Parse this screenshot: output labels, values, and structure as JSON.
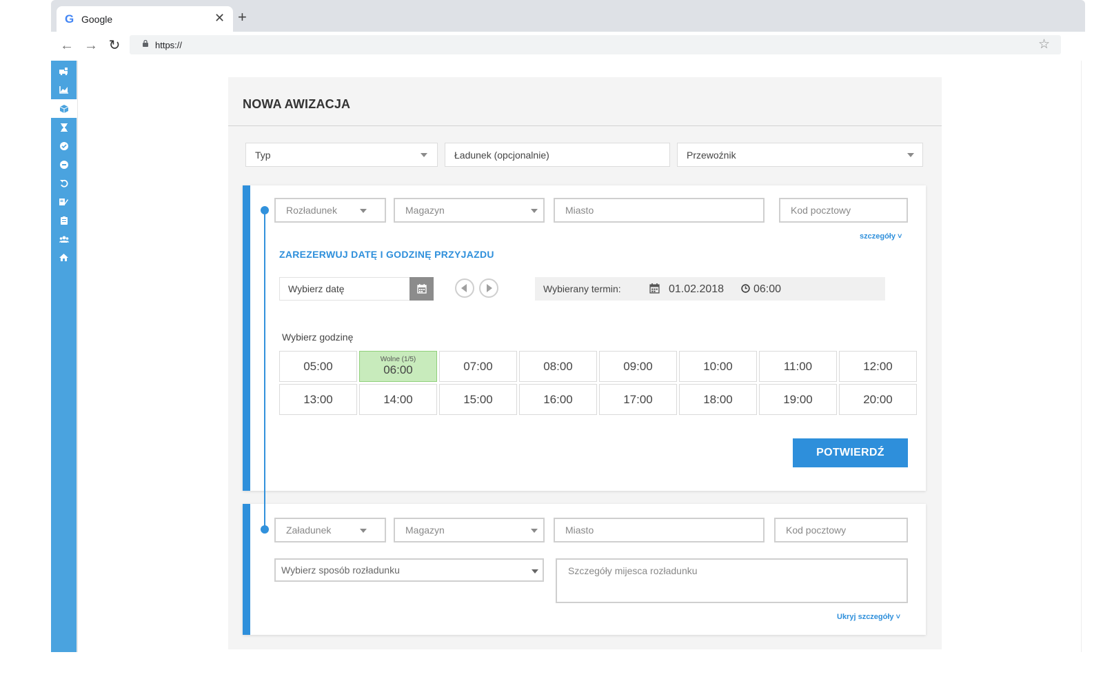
{
  "browser": {
    "tab_title": "Google",
    "tab_logo": "G",
    "tab_close": "✕",
    "new_tab": "+",
    "url": "https://",
    "icons": [
      "back-icon",
      "forward-icon",
      "reload-icon",
      "lock-icon",
      "star-icon"
    ]
  },
  "sidebar": {
    "items": [
      {
        "icon": "delivery-truck-icon"
      },
      {
        "icon": "chart-icon"
      },
      {
        "icon": "package-icon",
        "active": true
      },
      {
        "icon": "hourglass-icon"
      },
      {
        "icon": "check-circle-icon"
      },
      {
        "icon": "minus-circle-icon"
      },
      {
        "icon": "undo-icon"
      },
      {
        "icon": "edit-note-icon"
      },
      {
        "icon": "clipboard-icon"
      },
      {
        "icon": "users-icon"
      },
      {
        "icon": "home-icon"
      }
    ]
  },
  "form": {
    "title": "NOWA AWIZACJA",
    "type_placeholder": "Typ",
    "load_placeholder": "Ładunek (opcjonalnie)",
    "carrier_placeholder": "Przewoźnik"
  },
  "unloading": {
    "type": "Rozładunek",
    "warehouse": "Magazyn",
    "city": "Miasto",
    "postal": "Kod pocztowy",
    "details_link": "szczegóły ˅"
  },
  "booking": {
    "title": "ZAREZERWUJ DATĘ I GODZINĘ PRZYJAZDU",
    "date_placeholder": "Wybierz datę",
    "selected_label": "Wybierany termin:",
    "selected_date": "01.02.2018",
    "selected_time": "06:00",
    "hour_label": "Wybierz godzinę",
    "free_label": "Wolne (1/5)",
    "slots": [
      "05:00",
      "06:00",
      "07:00",
      "08:00",
      "09:00",
      "10:00",
      "11:00",
      "12:00",
      "13:00",
      "14:00",
      "15:00",
      "16:00",
      "17:00",
      "18:00",
      "19:00",
      "20:00"
    ],
    "selected_slot": "06:00",
    "confirm": "POTWIERDŹ"
  },
  "loading": {
    "type": "Załadunek",
    "warehouse": "Magazyn",
    "city": "Miasto",
    "postal": "Kod pocztowy",
    "method_placeholder": "Wybierz sposób rozładunku",
    "details_placeholder": "Szczegóły mijesca rozładunku",
    "hide_link": "Ukryj szczegóły ˅"
  },
  "colors": {
    "accent": "#2e8fdb",
    "sidebar": "#4aa3df",
    "free_slot": "#c8ebbc"
  }
}
